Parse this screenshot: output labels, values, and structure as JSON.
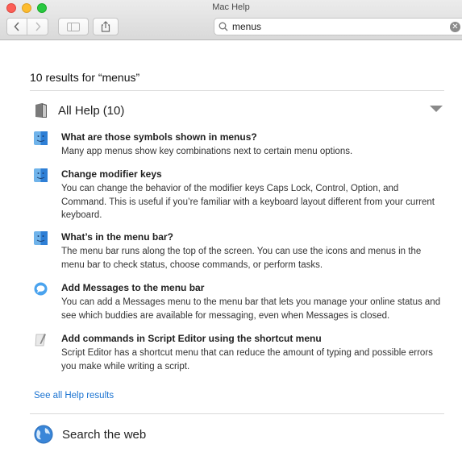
{
  "window": {
    "title": "Mac Help"
  },
  "toolbar": {
    "back_icon": "chevron-left-icon",
    "forward_icon": "chevron-right-icon",
    "sidebar_icon": "sidebar-icon",
    "share_icon": "share-icon",
    "search_value": "menus",
    "search_icon": "magnifier-icon",
    "clear_icon": "clear-icon"
  },
  "results": {
    "heading": "10 results for “menus”",
    "section": {
      "title": "All Help",
      "count": "(10)"
    },
    "items": [
      {
        "icon": "finder-icon",
        "title": "What are those symbols shown in menus?",
        "description": "Many app menus show key combinations next to certain menu options."
      },
      {
        "icon": "finder-icon",
        "title": "Change modifier keys",
        "description": "You can change the behavior of the modifier keys Caps Lock, Control, Option, and Command. This is useful if you’re familiar with a keyboard layout different from your current keyboard."
      },
      {
        "icon": "finder-icon",
        "title": "What’s in the menu bar?",
        "description": "The menu bar runs along the top of the screen. You can use the icons and menus in the menu bar to check status, choose commands, or perform tasks."
      },
      {
        "icon": "messages-icon",
        "title": "Add Messages to the menu bar",
        "description": "You can add a Messages menu to the menu bar that lets you manage your online status and see which buddies are available for messaging, even when Messages is closed."
      },
      {
        "icon": "script-editor-icon",
        "title": "Add commands in Script Editor using the shortcut menu",
        "description": "Script Editor has a shortcut menu that can reduce the amount of typing and possible errors you make while writing a script."
      }
    ],
    "see_all": "See all Help results",
    "web_label": "Search the web"
  }
}
